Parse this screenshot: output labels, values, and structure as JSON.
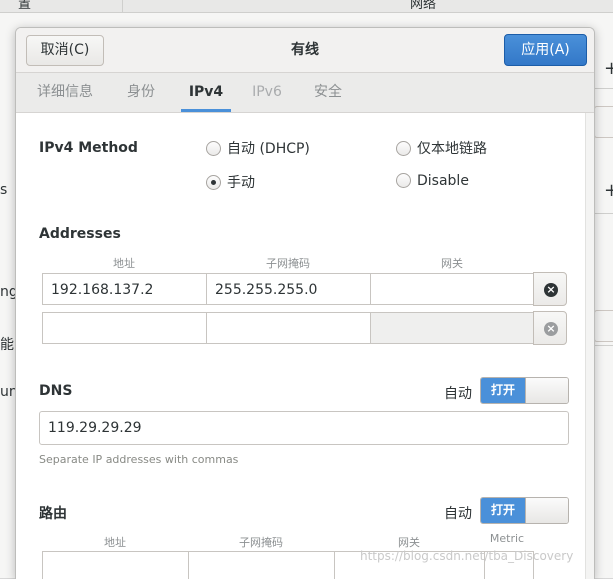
{
  "background": {
    "header_left": "置",
    "header_right": "网络",
    "side_texts": [
      "s",
      "ng",
      "能",
      "un"
    ]
  },
  "dialog": {
    "title": "有线",
    "cancel_label": "取消(C)",
    "apply_label": "应用(A)"
  },
  "tabs": [
    {
      "label": "详细信息",
      "state": "normal"
    },
    {
      "label": "身份",
      "state": "normal"
    },
    {
      "label": "IPv4",
      "state": "active"
    },
    {
      "label": "IPv6",
      "state": "disabled"
    },
    {
      "label": "安全",
      "state": "normal"
    }
  ],
  "ipv4": {
    "method_label": "IPv4 Method",
    "methods": [
      {
        "label": "自动 (DHCP)",
        "selected": false
      },
      {
        "label": "仅本地链路",
        "selected": false
      },
      {
        "label": "手动",
        "selected": true
      },
      {
        "label": "Disable",
        "selected": false
      }
    ],
    "addresses": {
      "label": "Addresses",
      "columns": [
        "地址",
        "子网掩码",
        "网关"
      ],
      "rows": [
        {
          "address": "192.168.137.2",
          "netmask": "255.255.255.0",
          "gateway": ""
        },
        {
          "address": "",
          "netmask": "",
          "gateway": ""
        }
      ]
    },
    "dns": {
      "label": "DNS",
      "auto_label": "自动",
      "toggle_label": "打开",
      "value": "119.29.29.29",
      "hint": "Separate IP addresses with commas"
    },
    "routes": {
      "label": "路由",
      "auto_label": "自动",
      "toggle_label": "打开",
      "columns": [
        "地址",
        "子网掩码",
        "网关",
        "Metric"
      ]
    }
  },
  "watermark": "https://blog.csdn.net/tba_Discovery",
  "colors": {
    "accent": "#4a90d9",
    "text": "#2e3436",
    "muted": "#8c9092"
  }
}
